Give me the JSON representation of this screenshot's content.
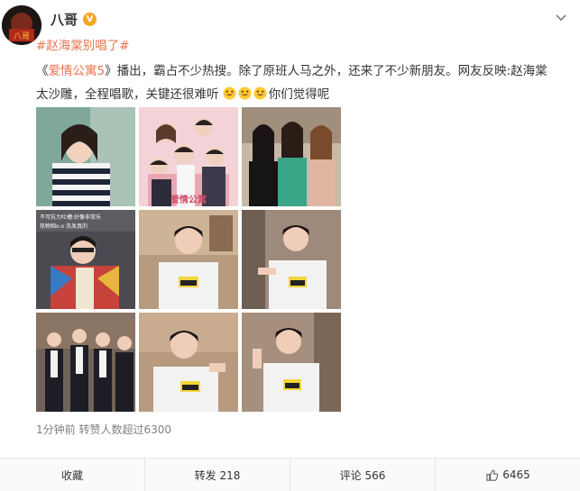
{
  "post": {
    "author": "八哥",
    "verified_badge": "V",
    "hashtag": "#赵海棠别唱了#",
    "text": {
      "prefix": "《",
      "show_link": "爱情公寓5",
      "after_link": "》播出，霸占不少热搜。除了原班人马之外，还来了不少新朋友。网友反映:赵海棠",
      "line2": "太沙雕，全程唱歌，关键还很难听",
      "suffix": "你们觉得呢"
    },
    "emojis": [
      "laugh-cry-emoji",
      "laugh-cry-emoji",
      "laugh-cry-emoji"
    ],
    "meta": "1分钟前 转赞人数超过6300",
    "images": [
      {
        "name": "photo-actress-striped-shirt"
      },
      {
        "name": "photo-cast-poster"
      },
      {
        "name": "photo-three-actresses"
      },
      {
        "name": "photo-man-with-caption"
      },
      {
        "name": "photo-man-singing-1"
      },
      {
        "name": "photo-man-singing-2"
      },
      {
        "name": "photo-group-performance"
      },
      {
        "name": "photo-man-singing-3"
      },
      {
        "name": "photo-man-singing-4"
      }
    ]
  },
  "actions": {
    "favorite": "收藏",
    "repost": "转发 218",
    "comment": "评论 566",
    "like": "6465"
  },
  "colors": {
    "link": "#eb7350",
    "badge": "#f5a623",
    "meta": "#808080"
  }
}
